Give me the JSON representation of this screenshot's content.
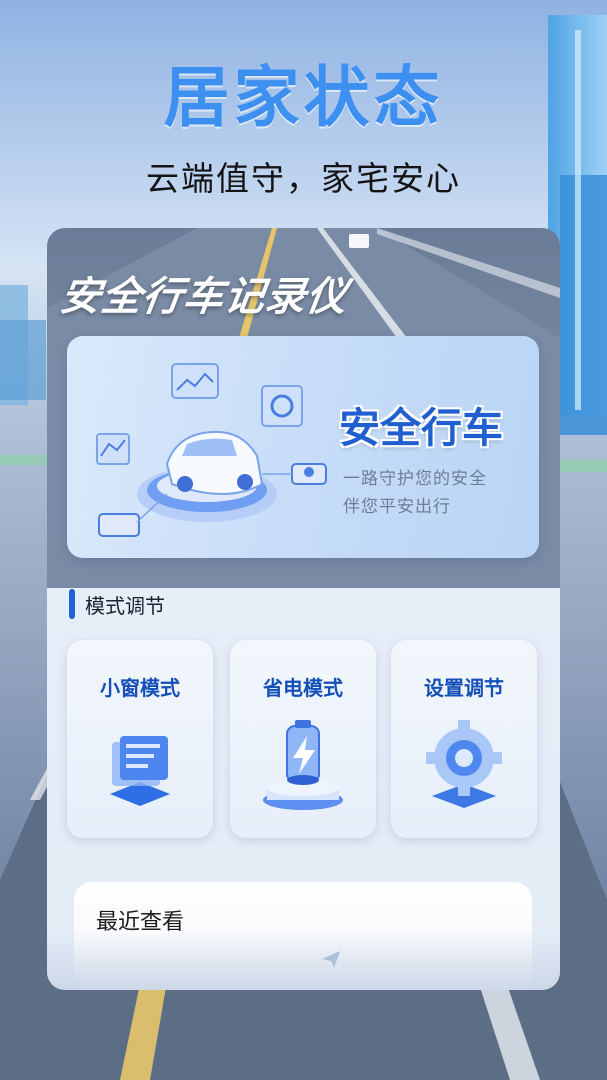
{
  "hero": {
    "title": "居家状态",
    "subtitle": "云端值守，家宅安心"
  },
  "card": {
    "heading": "安全行车记录仪",
    "banner": {
      "title": "安全行车",
      "line1": "一路守护您的安全",
      "line2": "伴您平安出行"
    },
    "section": {
      "label": "模式调节"
    },
    "tiles": [
      {
        "label": "小窗模式",
        "icon": "window-stack-icon"
      },
      {
        "label": "省电模式",
        "icon": "battery-charging-icon"
      },
      {
        "label": "设置调节",
        "icon": "gear-settings-icon"
      }
    ],
    "recent": {
      "title": "最近查看",
      "icon": "send-arrow-icon"
    }
  },
  "colors": {
    "accent": "#3d8ff0",
    "tile_label": "#1550b8",
    "section_bar": "#1e63d8"
  }
}
